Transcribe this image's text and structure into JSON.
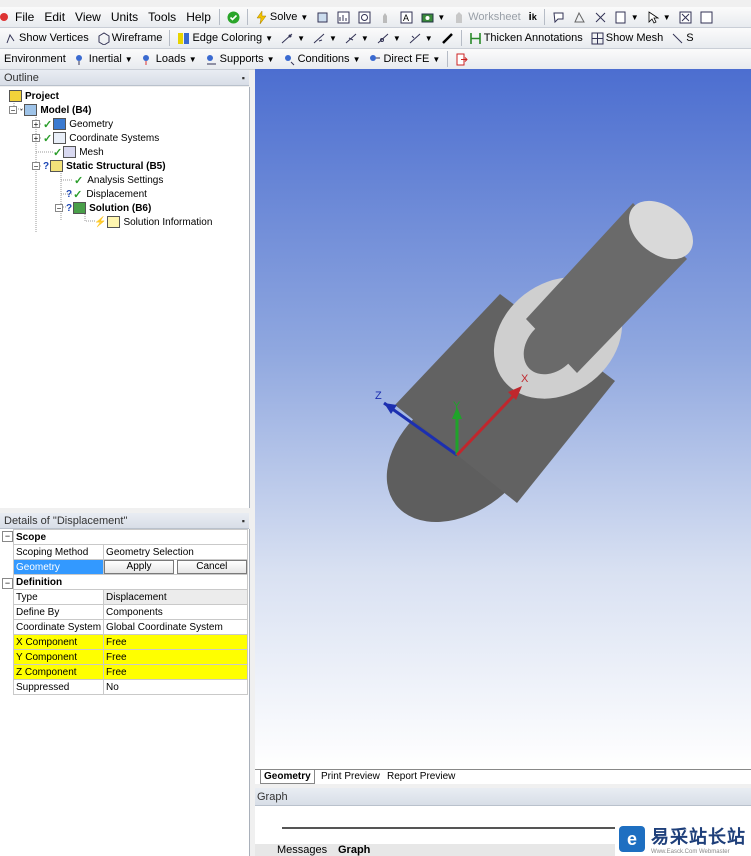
{
  "menu": [
    "File",
    "Edit",
    "View",
    "Units",
    "Tools",
    "Help"
  ],
  "toolbar1": {
    "solve": "Solve",
    "worksheet": "Worksheet"
  },
  "toolbar2": {
    "show_vertices": "Show Vertices",
    "wireframe": "Wireframe",
    "edge_coloring": "Edge Coloring",
    "thicken_annotations": "Thicken Annotations",
    "show_mesh": "Show Mesh",
    "cut_label": "S"
  },
  "toolbar3": {
    "environment": "Environment",
    "inertial": "Inertial",
    "loads": "Loads",
    "supports": "Supports",
    "conditions": "Conditions",
    "direct_fe": "Direct FE"
  },
  "outline": {
    "title": "Outline",
    "project": "Project",
    "model": "Model (B4)",
    "geometry": "Geometry",
    "coordinate_systems": "Coordinate Systems",
    "mesh": "Mesh",
    "static_structural": "Static Structural (B5)",
    "analysis_settings": "Analysis Settings",
    "displacement": "Displacement",
    "solution": "Solution (B6)",
    "solution_information": "Solution Information"
  },
  "details": {
    "title": "Details of \"Displacement\"",
    "scope": "Scope",
    "scoping_method_k": "Scoping Method",
    "scoping_method_v": "Geometry Selection",
    "geometry_k": "Geometry",
    "apply": "Apply",
    "cancel": "Cancel",
    "definition": "Definition",
    "type_k": "Type",
    "type_v": "Displacement",
    "define_by_k": "Define By",
    "define_by_v": "Components",
    "coord_k": "Coordinate System",
    "coord_v": "Global Coordinate System",
    "x_k": "X Component",
    "x_v": "Free",
    "y_k": "Y Component",
    "y_v": "Free",
    "z_k": "Z Component",
    "z_v": "Free",
    "suppressed_k": "Suppressed",
    "suppressed_v": "No",
    "expander": "−"
  },
  "viewport": {
    "axis_x": "X",
    "axis_y": "Y",
    "axis_z": "Z"
  },
  "view_tabs": [
    "Geometry",
    "Print Preview",
    "Report Preview"
  ],
  "graph": {
    "title": "Graph",
    "tabs": [
      "Messages",
      "Graph"
    ]
  },
  "watermark": {
    "brand": "易采站长站",
    "sub": "Www.Easck.Com Webmaster"
  },
  "colors": {
    "accent_blue": "#3399ff",
    "highlight_yellow": "#ffff00",
    "axis_x": "#c0272d",
    "axis_y": "#1fa32a",
    "axis_z": "#1c2fb0"
  }
}
